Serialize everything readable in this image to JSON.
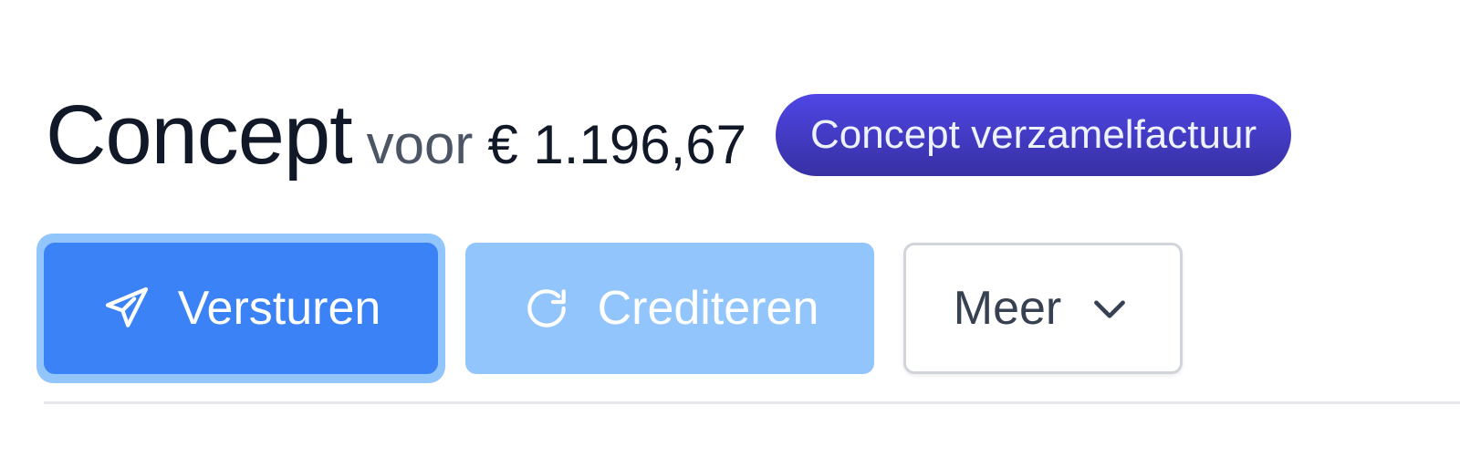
{
  "header": {
    "title": "Concept",
    "subtitle_prefix": "voor",
    "amount": "€ 1.196,67",
    "status_badge": "Concept verzamelfactuur"
  },
  "actions": {
    "send_label": "Versturen",
    "credit_label": "Crediteren",
    "more_label": "Meer"
  },
  "icons": {
    "send": "paper-plane-icon",
    "credit": "refresh-icon",
    "more": "chevron-down-icon"
  },
  "colors": {
    "primary": "#3b82f6",
    "primary_light": "#93c5fd",
    "badge": "#4338ca",
    "text_dark": "#111827",
    "text_muted": "#4b5563"
  }
}
